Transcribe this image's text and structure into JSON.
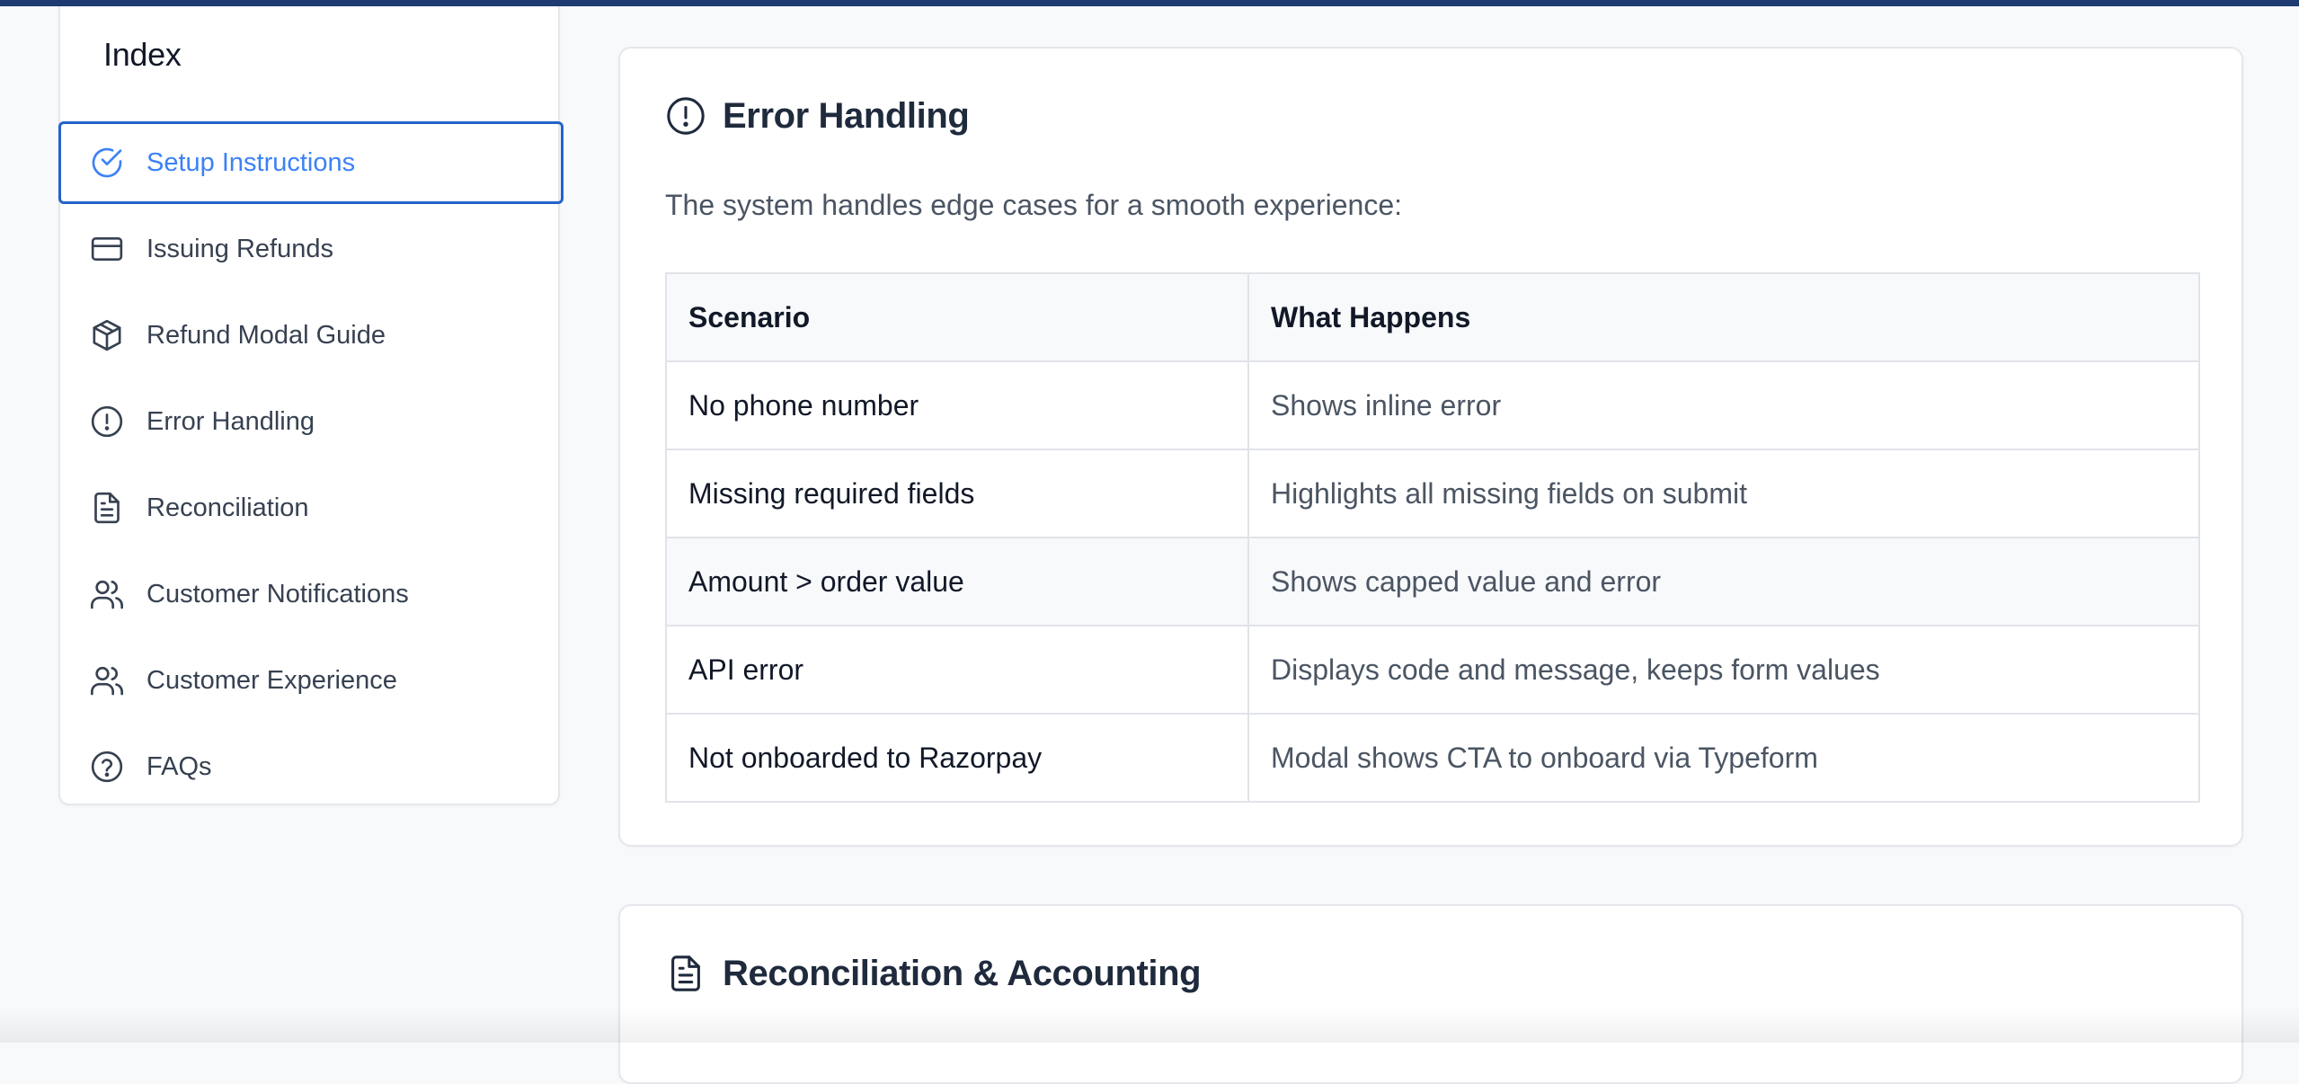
{
  "sidebar": {
    "title": "Index",
    "items": [
      {
        "label": "Setup Instructions",
        "icon": "check-circle-icon",
        "active": true
      },
      {
        "label": "Issuing Refunds",
        "icon": "credit-card-icon"
      },
      {
        "label": "Refund Modal Guide",
        "icon": "box-icon"
      },
      {
        "label": "Error Handling",
        "icon": "alert-circle-icon"
      },
      {
        "label": "Reconciliation",
        "icon": "document-icon"
      },
      {
        "label": "Customer Notifications",
        "icon": "users-icon"
      },
      {
        "label": "Customer Experience",
        "icon": "users-icon"
      },
      {
        "label": "FAQs",
        "icon": "help-circle-icon"
      }
    ]
  },
  "error_handling": {
    "title": "Error Handling",
    "icon": "alert-circle-icon",
    "intro": "The system handles edge cases for a smooth experience:",
    "table": {
      "headers": [
        "Scenario",
        "What Happens"
      ],
      "rows": [
        [
          "No phone number",
          "Shows inline error"
        ],
        [
          "Missing required fields",
          "Highlights all missing fields on submit"
        ],
        [
          "Amount > order value",
          "Shows capped value and error"
        ],
        [
          "API error",
          "Displays code and message, keeps form values"
        ],
        [
          "Not onboarded to Razorpay",
          "Modal shows CTA to onboard via Typeform"
        ]
      ]
    }
  },
  "reconciliation": {
    "title": "Reconciliation & Accounting",
    "icon": "document-icon"
  },
  "colors": {
    "accent": "#3b82f6",
    "active_border": "#2563c9",
    "topbar": "#1e3a72",
    "heading": "#1f2a3d"
  }
}
